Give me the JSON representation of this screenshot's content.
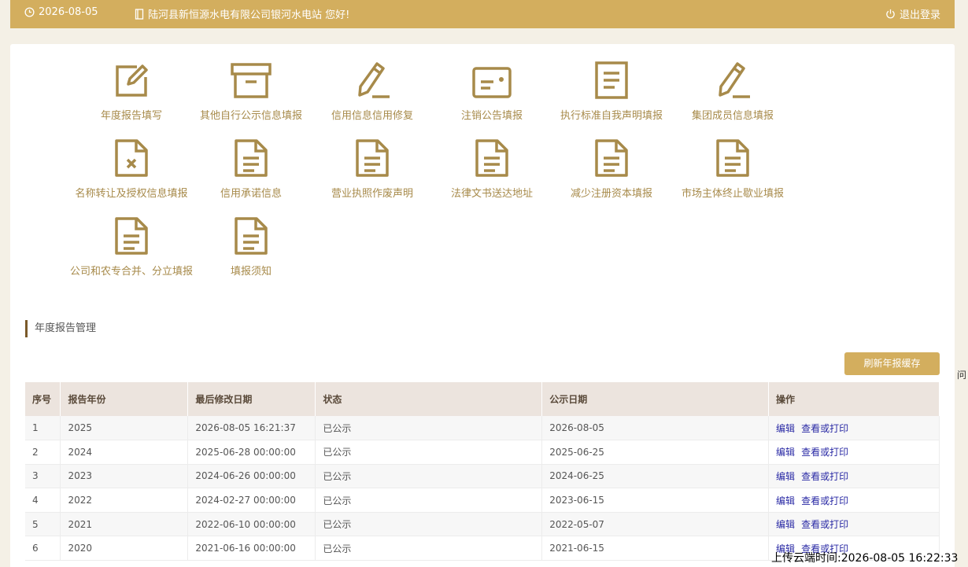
{
  "header": {
    "date": "2026-08-05",
    "greeting": "陆河县新恒源水电有限公司银河水电站 您好!",
    "logout_label": "退出登录",
    "date_icon": "clock-icon",
    "greeting_icon": "book-icon",
    "logout_icon": "power-icon"
  },
  "tiles": [
    {
      "label": "年度报告填写",
      "icon": "edit-icon"
    },
    {
      "label": "其他自行公示信息填报",
      "icon": "archive-icon"
    },
    {
      "label": "信用信息信用修复",
      "icon": "pencil-icon"
    },
    {
      "label": "注销公告填报",
      "icon": "card-icon"
    },
    {
      "label": "执行标准自我声明填报",
      "icon": "document-icon"
    },
    {
      "label": "集团成员信息填报",
      "icon": "pencil-icon"
    },
    {
      "label": "名称转让及授权信息填报",
      "icon": "file-x-icon"
    },
    {
      "label": "信用承诺信息",
      "icon": "file-text-icon"
    },
    {
      "label": "营业执照作废声明",
      "icon": "file-text-icon"
    },
    {
      "label": "法律文书送达地址",
      "icon": "file-text-icon"
    },
    {
      "label": "减少注册资本填报",
      "icon": "file-text-icon"
    },
    {
      "label": "市场主体终止歇业填报",
      "icon": "file-text-icon"
    },
    {
      "label": "公司和农专合并、分立填报",
      "icon": "file-text-icon"
    },
    {
      "label": "填报须知",
      "icon": "file-text-icon"
    }
  ],
  "section_title": "年度报告管理",
  "refresh_button": "刷新年报缓存",
  "table": {
    "headers": [
      "序号",
      "报告年份",
      "最后修改日期",
      "状态",
      "公示日期",
      "操作"
    ],
    "rows": [
      {
        "no": "1",
        "year": "2025",
        "modified": "2026-08-05 16:21:37",
        "status": "已公示",
        "publish": "2026-08-05"
      },
      {
        "no": "2",
        "year": "2024",
        "modified": "2025-06-28 00:00:00",
        "status": "已公示",
        "publish": "2025-06-25"
      },
      {
        "no": "3",
        "year": "2023",
        "modified": "2024-06-26 00:00:00",
        "status": "已公示",
        "publish": "2024-06-25"
      },
      {
        "no": "4",
        "year": "2022",
        "modified": "2024-02-27 00:00:00",
        "status": "已公示",
        "publish": "2023-06-15"
      },
      {
        "no": "5",
        "year": "2021",
        "modified": "2022-06-10 00:00:00",
        "status": "已公示",
        "publish": "2022-05-07"
      },
      {
        "no": "6",
        "year": "2020",
        "modified": "2021-06-16 00:00:00",
        "status": "已公示",
        "publish": "2021-06-15"
      }
    ],
    "edit_label": "编辑",
    "view_label": "查看或打印"
  },
  "side_char": "问",
  "upload_time": "上传云端时间:2026-08-05 16:22:33",
  "colors": {
    "accent": "#d3ae5e",
    "icon": "#a78a4a",
    "link": "#2a2aa5"
  }
}
